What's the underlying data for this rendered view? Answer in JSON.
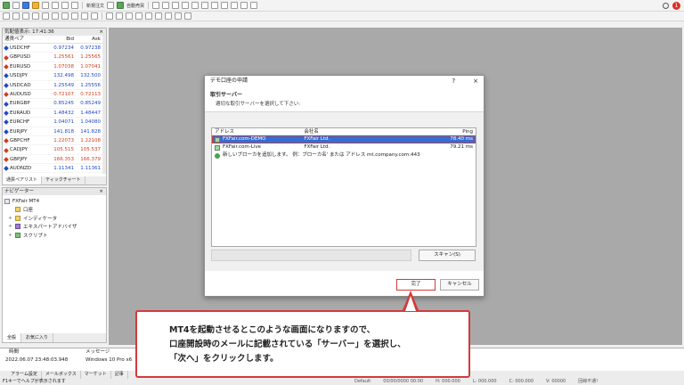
{
  "toolbar": {
    "new_order": "新規注文",
    "auto_trading": "自動売買",
    "badge_count": "1"
  },
  "market_watch": {
    "title": "気配値表示: 17:41:36",
    "headers": [
      "通貨ペア",
      "Bid",
      "Ask"
    ],
    "rows": [
      {
        "symbol": "USDCHF",
        "bid": "0.97234",
        "ask": "0.97238",
        "dir": "up"
      },
      {
        "symbol": "GBPUSD",
        "bid": "1.25561",
        "ask": "1.25565",
        "dir": "down"
      },
      {
        "symbol": "EURUSD",
        "bid": "1.07038",
        "ask": "1.07041",
        "dir": "down"
      },
      {
        "symbol": "USDJPY",
        "bid": "132.498",
        "ask": "132.500",
        "dir": "up"
      },
      {
        "symbol": "USDCAD",
        "bid": "1.25549",
        "ask": "1.25556",
        "dir": "up"
      },
      {
        "symbol": "AUDUSD",
        "bid": "0.72107",
        "ask": "0.72113",
        "dir": "down"
      },
      {
        "symbol": "EURGBP",
        "bid": "0.85245",
        "ask": "0.85249",
        "dir": "up"
      },
      {
        "symbol": "EURAUD",
        "bid": "1.48432",
        "ask": "1.48447",
        "dir": "up"
      },
      {
        "symbol": "EURCHF",
        "bid": "1.04071",
        "ask": "1.04080",
        "dir": "up"
      },
      {
        "symbol": "EURJPY",
        "bid": "141.818",
        "ask": "141.828",
        "dir": "up"
      },
      {
        "symbol": "GBPCHF",
        "bid": "1.22073",
        "ask": "1.22108",
        "dir": "down"
      },
      {
        "symbol": "CADJPY",
        "bid": "105.515",
        "ask": "105.537",
        "dir": "down"
      },
      {
        "symbol": "GBPJPY",
        "bid": "166.353",
        "ask": "166.379",
        "dir": "down"
      },
      {
        "symbol": "AUDNZD",
        "bid": "1.11341",
        "ask": "1.11361",
        "dir": "up"
      }
    ],
    "tabs": [
      "通貨ペアリスト",
      "ティックチャート"
    ]
  },
  "navigator": {
    "title": "ナビゲーター",
    "root": "FXFair MT4",
    "items": [
      "口座",
      "インディケータ",
      "エキスパートアドバイザ",
      "スクリプト"
    ],
    "tabs": [
      "全般",
      "お気に入り"
    ]
  },
  "terminal": {
    "headers": [
      "時間",
      "メッセージ"
    ],
    "row_time": "2022.06.07 23:48:03.948",
    "row_msg": "Windows 10 Pro x6",
    "tabs": [
      "アラーム設定",
      "メールボックス",
      "マーケット",
      "記事"
    ]
  },
  "statusbar": {
    "left": "F1キーでヘルプが表示されます",
    "default": "Default",
    "time": "00/00/0000 00:00",
    "o": "H: 000.000",
    "h": "L: 000.000",
    "c": "C: 000.000",
    "v": "V: 00000",
    "conn": "回線不通!"
  },
  "dialog": {
    "title": "デモ口座の申請",
    "help": "?",
    "close": "×",
    "heading": "取引サーバー",
    "subheading": "適切な取引サーバーを選択して下さい:",
    "columns": [
      "アドレス",
      "会社名",
      "Ping"
    ],
    "servers": [
      {
        "address": "FXFair.com-DEMO",
        "company": "FXFair Ltd.",
        "ping": "78.40 ms"
      },
      {
        "address": "FXFair.com-Live",
        "company": "FXFair Ltd.",
        "ping": "79.21 ms"
      }
    ],
    "add_broker": "新しいブローカを追加します。 例：ブローカ名' または アドレス mt.company.com:443",
    "scan": "スキャン(S)",
    "finish": "完了",
    "cancel": "キャンセル"
  },
  "callout": {
    "line1": "MT4を起動させるとこのような画面になりますので、",
    "line2": "口座開設時のメールに記載されている「サーバー」を選択し、",
    "line3": "「次へ」をクリックします。"
  },
  "colors": {
    "up": "#1f47c9",
    "down": "#d23b1e",
    "highlight_red": "#d23a3a",
    "selection_blue": "#2f6fd6"
  }
}
